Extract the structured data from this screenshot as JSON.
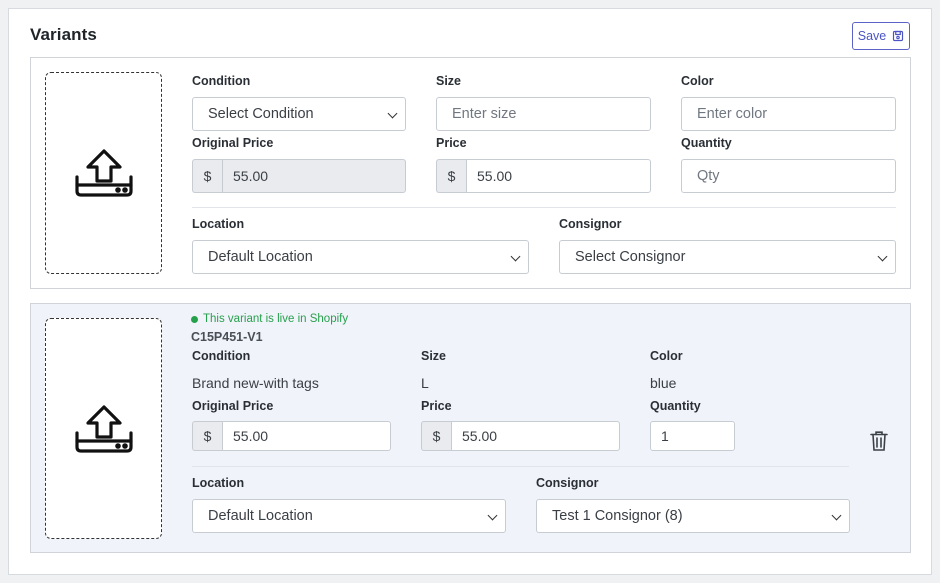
{
  "card": {
    "title": "Variants",
    "save_label": "Save"
  },
  "new_variant": {
    "labels": {
      "condition": "Condition",
      "size": "Size",
      "color": "Color",
      "original_price": "Original Price",
      "price": "Price",
      "quantity": "Quantity",
      "location": "Location",
      "consignor": "Consignor"
    },
    "condition_select": "Select Condition",
    "size_placeholder": "Enter size",
    "color_placeholder": "Enter color",
    "currency": "$",
    "original_price": "55.00",
    "price": "55.00",
    "quantity_placeholder": "Qty",
    "location_select": "Default Location",
    "consignor_select": "Select Consignor"
  },
  "existing_variant": {
    "live_status": "This variant is live in Shopify",
    "sku": "C15P451-V1",
    "labels": {
      "condition": "Condition",
      "size": "Size",
      "color": "Color",
      "original_price": "Original Price",
      "price": "Price",
      "quantity": "Quantity",
      "location": "Location",
      "consignor": "Consignor"
    },
    "condition": "Brand new-with tags",
    "size": "L",
    "color": "blue",
    "currency": "$",
    "original_price": "55.00",
    "price": "55.00",
    "quantity": "1",
    "location_select": "Default Location",
    "consignor_select": "Test 1 Consignor (8)"
  },
  "colors": {
    "accent": "#4b54c4",
    "live_green": "#24a14a",
    "variant_bg": "#f1f3fa"
  },
  "icons": [
    "save-icon",
    "upload-icon",
    "trash-icon"
  ]
}
